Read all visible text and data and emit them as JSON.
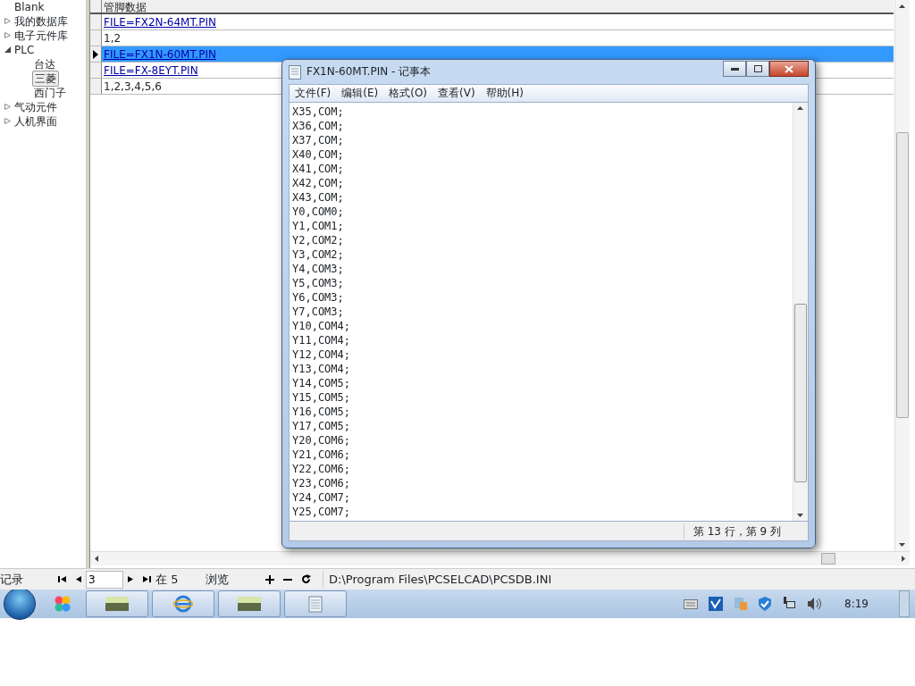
{
  "tree": [
    {
      "label": "Blank",
      "selected": false
    },
    {
      "label": "我的数据库",
      "expanded": false,
      "selected": false
    },
    {
      "label": "电子元件库",
      "expanded": false,
      "selected": false
    },
    {
      "label": "PLC",
      "expanded": true,
      "selected": false,
      "children": [
        {
          "label": "台达",
          "selected": false
        },
        {
          "label": "三菱",
          "selected": true
        },
        {
          "label": "西门子",
          "selected": false
        }
      ]
    },
    {
      "label": "气动元件",
      "expanded": false,
      "selected": false
    },
    {
      "label": "人机界面",
      "expanded": false,
      "selected": false
    }
  ],
  "table": {
    "columns": [
      "管脚数据"
    ],
    "rows": [
      {
        "kind": "link",
        "text": "FILE=FX2N-64MT.PIN",
        "selected": false
      },
      {
        "kind": "text",
        "text": "1,2",
        "selected": false
      },
      {
        "kind": "link",
        "text": "FILE=FX1N-60MT.PIN",
        "selected": true
      },
      {
        "kind": "link",
        "text": "FILE=FX-8EYT.PIN",
        "selected": false
      },
      {
        "kind": "text",
        "text": "1,2,3,4,5,6",
        "selected": false
      }
    ]
  },
  "navigator": {
    "label": "记录",
    "record": "3",
    "total": "在 5",
    "mode": "浏览",
    "path": "D:\\Program Files\\PCSELCAD\\PCSDB.INI"
  },
  "notepad": {
    "title": "FX1N-60MT.PIN - 记事本",
    "menu": [
      "文件(F)",
      "编辑(E)",
      "格式(O)",
      "查看(V)",
      "帮助(H)"
    ],
    "lines": [
      "X35,COM;",
      "X36,COM;",
      "X37,COM;",
      "X40,COM;",
      "X41,COM;",
      "X42,COM;",
      "X43,COM;",
      "Y0,COM0;",
      "Y1,COM1;",
      "Y2,COM2;",
      "Y3,COM2;",
      "Y4,COM3;",
      "Y5,COM3;",
      "Y6,COM3;",
      "Y7,COM3;",
      "Y10,COM4;",
      "Y11,COM4;",
      "Y12,COM4;",
      "Y13,COM4;",
      "Y14,COM5;",
      "Y15,COM5;",
      "Y16,COM5;",
      "Y17,COM5;",
      "Y20,COM6;",
      "Y21,COM6;",
      "Y22,COM6;",
      "Y23,COM6;",
      "Y24,COM7;",
      "Y25,COM7;"
    ],
    "status": "第 13 行，第 9 列"
  },
  "taskbar": {
    "clock": "8:19"
  }
}
